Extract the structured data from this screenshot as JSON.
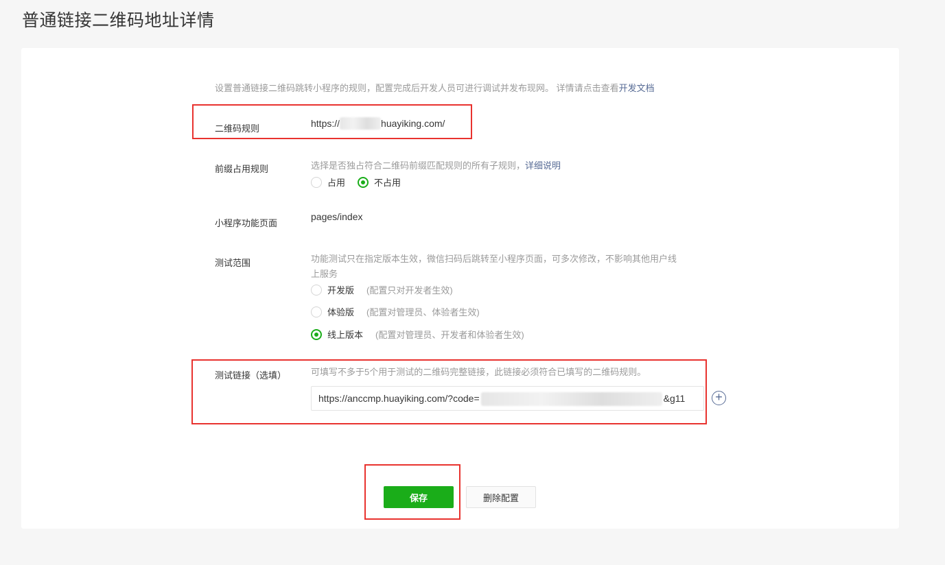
{
  "page": {
    "title": "普通链接二维码地址详情"
  },
  "intro": {
    "text": "设置普通链接二维码跳转小程序的规则，配置完成后开发人员可进行调试并发布现网。 详情请点击查看",
    "link": "开发文档"
  },
  "qr_rule": {
    "label": "二维码规则",
    "value_prefix": "https://",
    "value_suffix": "huayiking.com/"
  },
  "prefix_rule": {
    "label": "前缀占用规则",
    "desc": "选择是否独占符合二维码前缀匹配规则的所有子规则，",
    "desc_link": "详细说明",
    "options": [
      "占用",
      "不占用"
    ],
    "selected": "不占用"
  },
  "page_path": {
    "label": "小程序功能页面",
    "value": "pages/index"
  },
  "test_scope": {
    "label": "测试范围",
    "desc_line1": "功能测试只在指定版本生效，微信扫码后跳转至小程序页面，可多次修改，不影响其他用户线",
    "desc_line2": "上服务",
    "options": [
      {
        "label": "开发版",
        "note": "(配置只对开发者生效)"
      },
      {
        "label": "体验版",
        "note": "(配置对管理员、体验者生效)"
      },
      {
        "label": "线上版本",
        "note": "(配置对管理员、开发者和体验者生效)"
      }
    ],
    "selected": "线上版本"
  },
  "test_link": {
    "label": "测试链接（选填）",
    "desc": "可填写不多于5个用于测试的二维码完整链接，此链接必须符合已填写的二维码规则。",
    "value_prefix": "https://anccmp.huayiking.com/?code=",
    "value_suffix": "&g11"
  },
  "actions": {
    "save": "保存",
    "delete": "删除配置"
  },
  "colors": {
    "accent": "#1aad19",
    "link": "#576b95",
    "highlight": "#e8322e"
  },
  "icons": {
    "add": "plus-circle-icon"
  }
}
